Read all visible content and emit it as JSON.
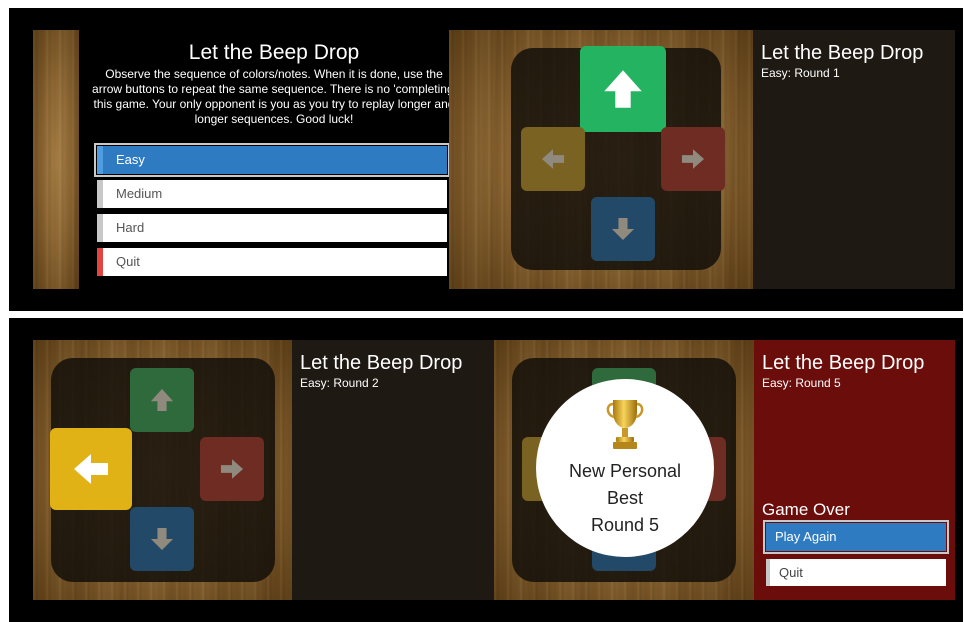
{
  "game_title": "Let the Beep Drop",
  "menu": {
    "description": "Observe the sequence of colors/notes. When it is done, use the arrow buttons to repeat the same sequence. There is no 'completing' this game. Your only opponent is you as you try to replay longer and longer sequences. Good luck!",
    "items": [
      {
        "label": "Easy",
        "selected": true
      },
      {
        "label": "Medium",
        "selected": false
      },
      {
        "label": "Hard",
        "selected": false
      },
      {
        "label": "Quit",
        "selected": false
      }
    ]
  },
  "panels": {
    "round1": {
      "status": "Easy: Round 1",
      "lit_button": "up"
    },
    "round2": {
      "status": "Easy: Round 2",
      "lit_button": "left"
    },
    "round5": {
      "status": "Easy: Round 5",
      "bubble_line1": "New Personal",
      "bubble_line2": "Best",
      "bubble_line3": "Round 5",
      "game_over_label": "Game Over",
      "play_again_label": "Play Again",
      "quit_label": "Quit"
    }
  },
  "colors": {
    "green": "#24b360",
    "yellow": "#e0b216",
    "red": "#6e2c22",
    "blue": "#224a68",
    "menu_selected": "#2e7bc1",
    "game_over_bg": "#6b0d0a"
  },
  "icons": [
    "arrow-up-icon",
    "arrow-left-icon",
    "arrow-right-icon",
    "arrow-down-icon",
    "trophy-icon"
  ]
}
